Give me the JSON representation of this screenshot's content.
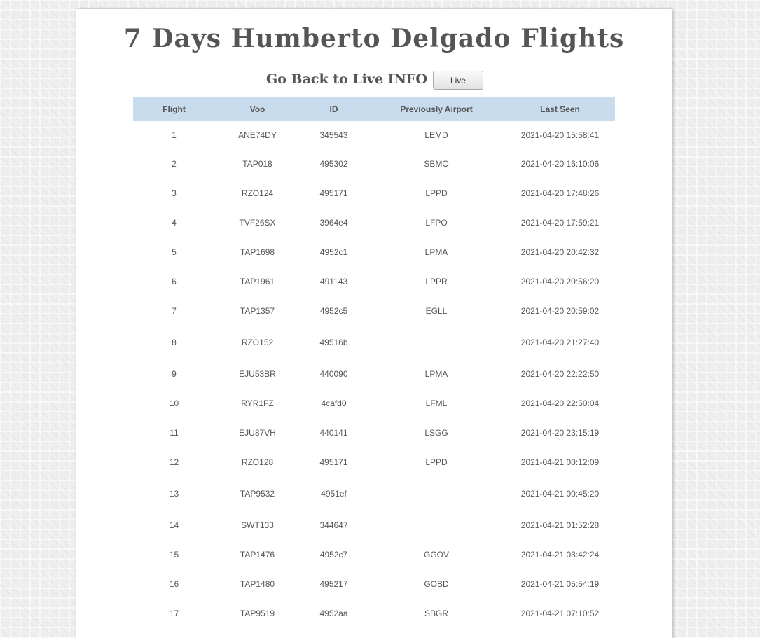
{
  "page": {
    "title": "7 Days Humberto Delgado Flights",
    "live_label": "Go Back to Live INFO",
    "live_button": "Live"
  },
  "table": {
    "headers": [
      "Flight",
      "Voo",
      "ID",
      "Previously Airport",
      "Last Seen"
    ],
    "rows": [
      {
        "flight": "1",
        "voo": "ANE74DY",
        "id": "345543",
        "airport": "LEMD",
        "last_seen": "2021-04-20 15:58:41"
      },
      {
        "flight": "2",
        "voo": "TAP018",
        "id": "495302",
        "airport": "SBMO",
        "last_seen": "2021-04-20 16:10:06"
      },
      {
        "flight": "3",
        "voo": "RZO124",
        "id": "495171",
        "airport": "LPPD",
        "last_seen": "2021-04-20 17:48:26"
      },
      {
        "flight": "4",
        "voo": "TVF26SX",
        "id": "3964e4",
        "airport": "LFPO",
        "last_seen": "2021-04-20 17:59:21"
      },
      {
        "flight": "5",
        "voo": "TAP1698",
        "id": "4952c1",
        "airport": "LPMA",
        "last_seen": "2021-04-20 20:42:32"
      },
      {
        "flight": "6",
        "voo": "TAP1961",
        "id": "491143",
        "airport": "LPPR",
        "last_seen": "2021-04-20 20:56:20"
      },
      {
        "flight": "7",
        "voo": "TAP1357",
        "id": "4952c5",
        "airport": "EGLL",
        "last_seen": "2021-04-20 20:59:02"
      },
      {
        "flight": "8",
        "voo": "RZO152",
        "id": "49516b",
        "airport": "",
        "last_seen": "2021-04-20 21:27:40"
      },
      {
        "flight": "9",
        "voo": "EJU53BR",
        "id": "440090",
        "airport": "LPMA",
        "last_seen": "2021-04-20 22:22:50"
      },
      {
        "flight": "10",
        "voo": "RYR1FZ",
        "id": "4cafd0",
        "airport": "LFML",
        "last_seen": "2021-04-20 22:50:04"
      },
      {
        "flight": "11",
        "voo": "EJU87VH",
        "id": "440141",
        "airport": "LSGG",
        "last_seen": "2021-04-20 23:15:19"
      },
      {
        "flight": "12",
        "voo": "RZO128",
        "id": "495171",
        "airport": "LPPD",
        "last_seen": "2021-04-21 00:12:09"
      },
      {
        "flight": "13",
        "voo": "TAP9532",
        "id": "4951ef",
        "airport": "",
        "last_seen": "2021-04-21 00:45:20"
      },
      {
        "flight": "14",
        "voo": "SWT133",
        "id": "344647",
        "airport": "",
        "last_seen": "2021-04-21 01:52:28"
      },
      {
        "flight": "15",
        "voo": "TAP1476",
        "id": "4952c7",
        "airport": "GGOV",
        "last_seen": "2021-04-21 03:42:24"
      },
      {
        "flight": "16",
        "voo": "TAP1480",
        "id": "495217",
        "airport": "GOBD",
        "last_seen": "2021-04-21 05:54:19"
      },
      {
        "flight": "17",
        "voo": "TAP9519",
        "id": "4952aa",
        "airport": "SBGR",
        "last_seen": "2021-04-21 07:10:52"
      }
    ]
  },
  "colors": {
    "header_bg": "#c8dcee",
    "text": "#555555",
    "panel": "#ffffff"
  }
}
